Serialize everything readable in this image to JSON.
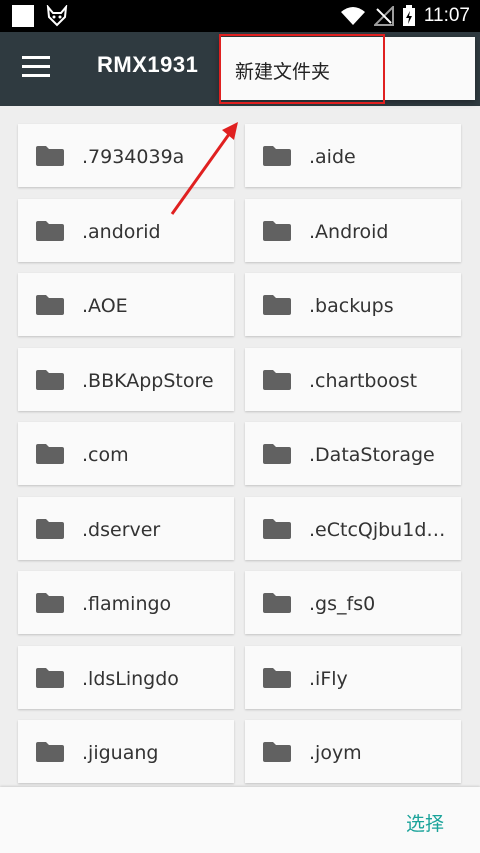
{
  "status_bar": {
    "time": "11:07",
    "icons": [
      "square-notification-icon",
      "fox-app-icon",
      "wifi-icon",
      "no-signal-icon",
      "battery-charging-icon"
    ]
  },
  "app_bar": {
    "title": "RMX1931",
    "menu_icon": "hamburger-menu-icon"
  },
  "popup_menu": {
    "items": [
      {
        "label": "新建文件夹"
      }
    ]
  },
  "annotation": {
    "highlight_color": "#e02020"
  },
  "folders": [
    {
      "name": ".7934039a"
    },
    {
      "name": ".aide"
    },
    {
      "name": ".andorid"
    },
    {
      "name": ".Android"
    },
    {
      "name": ".AOE"
    },
    {
      "name": ".backups"
    },
    {
      "name": ".BBKAppStore"
    },
    {
      "name": ".chartboost"
    },
    {
      "name": ".com"
    },
    {
      "name": ".DataStorage"
    },
    {
      "name": ".dserver"
    },
    {
      "name": ".eCtcQjbu1d…"
    },
    {
      "name": ".flamingo"
    },
    {
      "name": ".gs_fs0"
    },
    {
      "name": ".ldsLingdo"
    },
    {
      "name": ".iFly"
    },
    {
      "name": ".jiguang"
    },
    {
      "name": ".joym"
    }
  ],
  "bottom_bar": {
    "select_label": "选择"
  },
  "colors": {
    "app_bar": "#2f3a40",
    "accent": "#1aa39a",
    "folder_icon": "#616161"
  }
}
